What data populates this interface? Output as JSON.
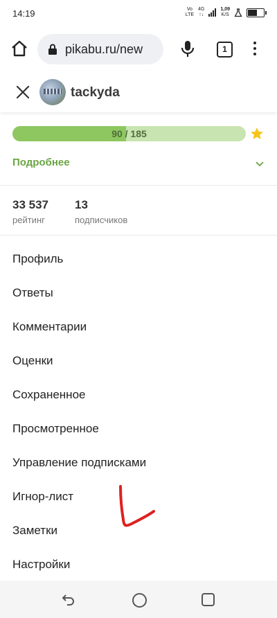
{
  "status_bar": {
    "time": "14:19",
    "network_top": "Vo",
    "network_bottom": "LTE",
    "signal_label_top": "4G",
    "speed_value": "1,09",
    "speed_unit": "K/S"
  },
  "browser": {
    "url": "pikabu.ru/new",
    "tab_count": "1"
  },
  "profile": {
    "username": "tackyda"
  },
  "rating_bar": {
    "text": "90 / 185",
    "progress": 0.486
  },
  "details": {
    "label": "Подробнее"
  },
  "stats": [
    {
      "value": "33 537",
      "label": "рейтинг"
    },
    {
      "value": "13",
      "label": "подписчиков"
    }
  ],
  "menu": [
    {
      "label": "Профиль"
    },
    {
      "label": "Ответы"
    },
    {
      "label": "Комментарии"
    },
    {
      "label": "Оценки"
    },
    {
      "label": "Сохраненное"
    },
    {
      "label": "Просмотренное"
    },
    {
      "label": "Управление подписками"
    },
    {
      "label": "Игнор-лист"
    },
    {
      "label": "Заметки"
    },
    {
      "label": "Настройки"
    }
  ],
  "colors": {
    "accent_green": "#6aa542",
    "bar_fill": "#8ec760",
    "bar_track": "#c8e4b0",
    "star": "#f5c518",
    "annotation": "#e02020"
  }
}
